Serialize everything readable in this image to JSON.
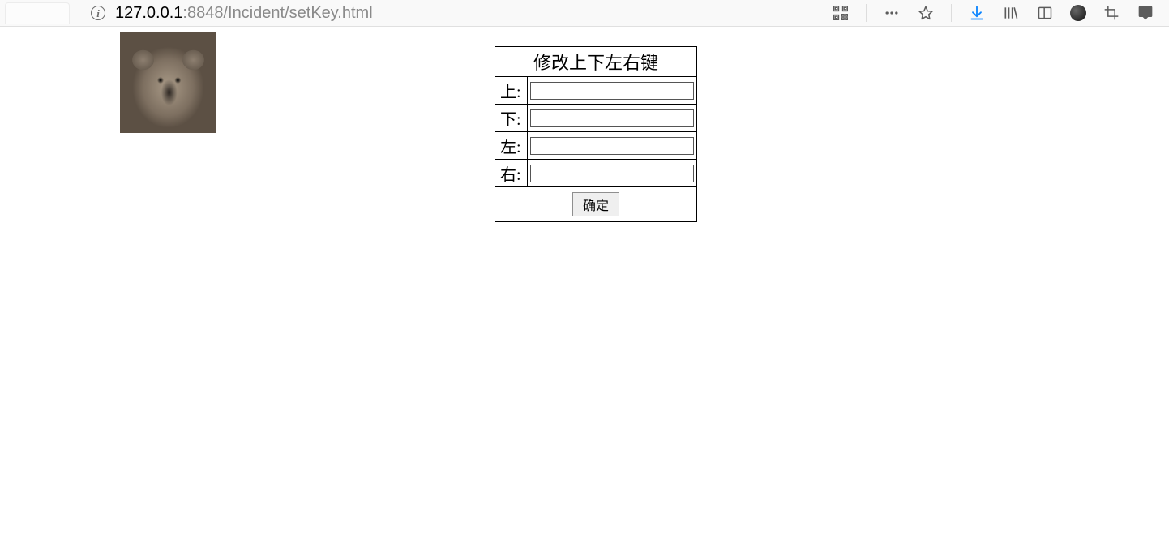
{
  "browser": {
    "url_host": "127.0.0.1",
    "url_port": ":8848",
    "url_path": "/Incident/setKey.html"
  },
  "form": {
    "title": "修改上下左右键",
    "rows": [
      {
        "label": "上:",
        "value": ""
      },
      {
        "label": "下:",
        "value": ""
      },
      {
        "label": "左:",
        "value": ""
      },
      {
        "label": "右:",
        "value": ""
      }
    ],
    "submit_label": "确定"
  }
}
